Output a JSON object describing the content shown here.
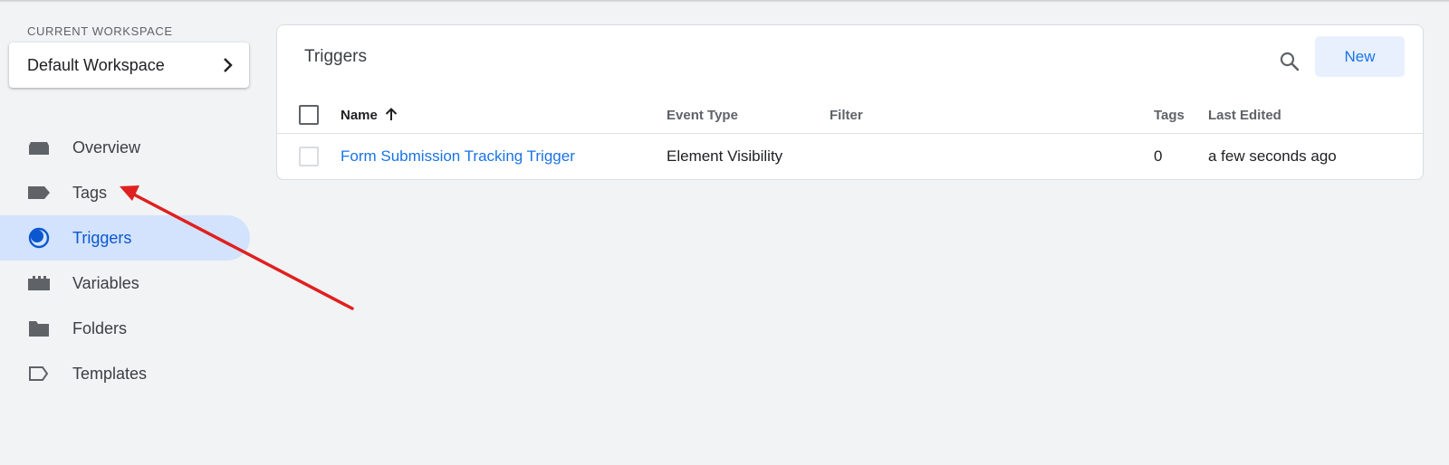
{
  "workspace": {
    "section_label": "CURRENT WORKSPACE",
    "name": "Default Workspace"
  },
  "sidebar": {
    "items": [
      {
        "label": "Overview",
        "icon": "overview-icon"
      },
      {
        "label": "Tags",
        "icon": "tag-icon"
      },
      {
        "label": "Triggers",
        "icon": "triggers-icon",
        "active": true
      },
      {
        "label": "Variables",
        "icon": "variables-icon"
      },
      {
        "label": "Folders",
        "icon": "folder-icon"
      },
      {
        "label": "Templates",
        "icon": "template-icon"
      }
    ]
  },
  "panel": {
    "title": "Triggers",
    "new_label": "New",
    "columns": {
      "name": "Name",
      "event_type": "Event Type",
      "filter": "Filter",
      "tags": "Tags",
      "last_edited": "Last Edited"
    },
    "sort_icon": "arrow-up-icon",
    "rows": [
      {
        "name": "Form Submission Tracking Trigger",
        "event_type": "Element Visibility",
        "filter": "",
        "tags": "0",
        "last_edited": "a few seconds ago"
      }
    ]
  },
  "colors": {
    "accent": "#1a73e8",
    "active_bg": "#d3e3fd",
    "annotation_arrow": "#e02020"
  }
}
